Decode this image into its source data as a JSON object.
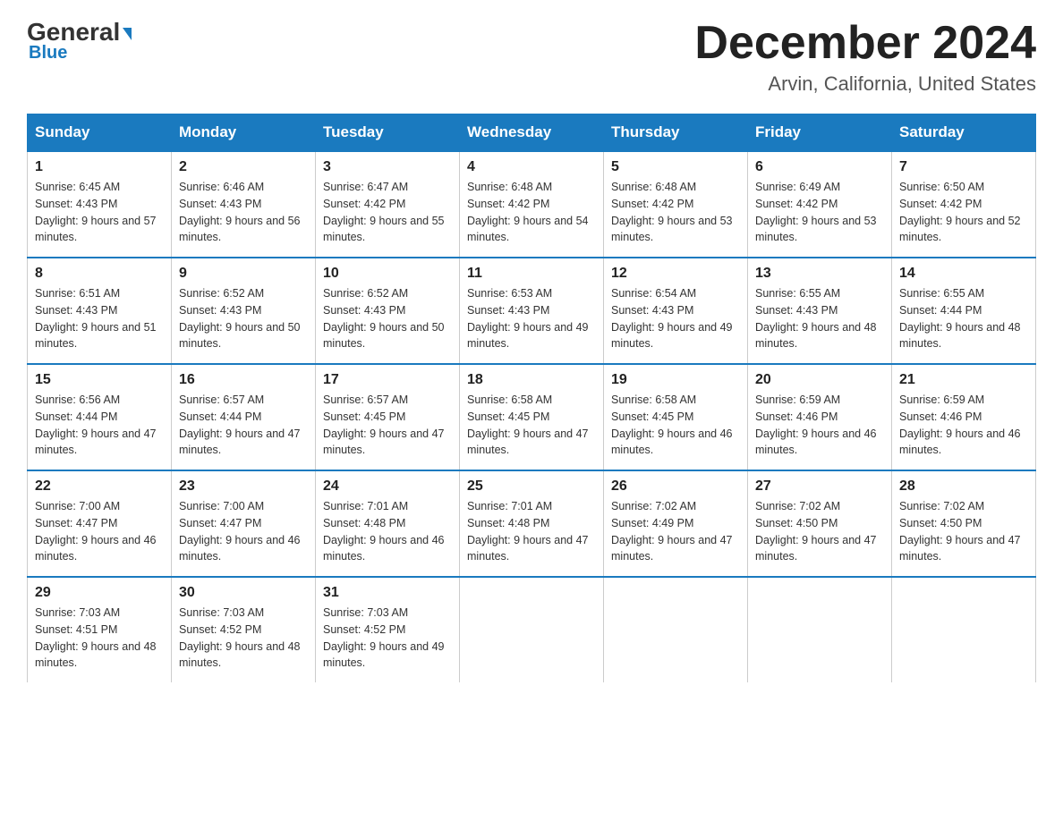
{
  "header": {
    "logo_general": "General",
    "logo_blue": "Blue",
    "month_title": "December 2024",
    "location": "Arvin, California, United States"
  },
  "days_of_week": [
    "Sunday",
    "Monday",
    "Tuesday",
    "Wednesday",
    "Thursday",
    "Friday",
    "Saturday"
  ],
  "weeks": [
    [
      {
        "day": "1",
        "sunrise": "6:45 AM",
        "sunset": "4:43 PM",
        "daylight": "9 hours and 57 minutes."
      },
      {
        "day": "2",
        "sunrise": "6:46 AM",
        "sunset": "4:43 PM",
        "daylight": "9 hours and 56 minutes."
      },
      {
        "day": "3",
        "sunrise": "6:47 AM",
        "sunset": "4:42 PM",
        "daylight": "9 hours and 55 minutes."
      },
      {
        "day": "4",
        "sunrise": "6:48 AM",
        "sunset": "4:42 PM",
        "daylight": "9 hours and 54 minutes."
      },
      {
        "day": "5",
        "sunrise": "6:48 AM",
        "sunset": "4:42 PM",
        "daylight": "9 hours and 53 minutes."
      },
      {
        "day": "6",
        "sunrise": "6:49 AM",
        "sunset": "4:42 PM",
        "daylight": "9 hours and 53 minutes."
      },
      {
        "day": "7",
        "sunrise": "6:50 AM",
        "sunset": "4:42 PM",
        "daylight": "9 hours and 52 minutes."
      }
    ],
    [
      {
        "day": "8",
        "sunrise": "6:51 AM",
        "sunset": "4:43 PM",
        "daylight": "9 hours and 51 minutes."
      },
      {
        "day": "9",
        "sunrise": "6:52 AM",
        "sunset": "4:43 PM",
        "daylight": "9 hours and 50 minutes."
      },
      {
        "day": "10",
        "sunrise": "6:52 AM",
        "sunset": "4:43 PM",
        "daylight": "9 hours and 50 minutes."
      },
      {
        "day": "11",
        "sunrise": "6:53 AM",
        "sunset": "4:43 PM",
        "daylight": "9 hours and 49 minutes."
      },
      {
        "day": "12",
        "sunrise": "6:54 AM",
        "sunset": "4:43 PM",
        "daylight": "9 hours and 49 minutes."
      },
      {
        "day": "13",
        "sunrise": "6:55 AM",
        "sunset": "4:43 PM",
        "daylight": "9 hours and 48 minutes."
      },
      {
        "day": "14",
        "sunrise": "6:55 AM",
        "sunset": "4:44 PM",
        "daylight": "9 hours and 48 minutes."
      }
    ],
    [
      {
        "day": "15",
        "sunrise": "6:56 AM",
        "sunset": "4:44 PM",
        "daylight": "9 hours and 47 minutes."
      },
      {
        "day": "16",
        "sunrise": "6:57 AM",
        "sunset": "4:44 PM",
        "daylight": "9 hours and 47 minutes."
      },
      {
        "day": "17",
        "sunrise": "6:57 AM",
        "sunset": "4:45 PM",
        "daylight": "9 hours and 47 minutes."
      },
      {
        "day": "18",
        "sunrise": "6:58 AM",
        "sunset": "4:45 PM",
        "daylight": "9 hours and 47 minutes."
      },
      {
        "day": "19",
        "sunrise": "6:58 AM",
        "sunset": "4:45 PM",
        "daylight": "9 hours and 46 minutes."
      },
      {
        "day": "20",
        "sunrise": "6:59 AM",
        "sunset": "4:46 PM",
        "daylight": "9 hours and 46 minutes."
      },
      {
        "day": "21",
        "sunrise": "6:59 AM",
        "sunset": "4:46 PM",
        "daylight": "9 hours and 46 minutes."
      }
    ],
    [
      {
        "day": "22",
        "sunrise": "7:00 AM",
        "sunset": "4:47 PM",
        "daylight": "9 hours and 46 minutes."
      },
      {
        "day": "23",
        "sunrise": "7:00 AM",
        "sunset": "4:47 PM",
        "daylight": "9 hours and 46 minutes."
      },
      {
        "day": "24",
        "sunrise": "7:01 AM",
        "sunset": "4:48 PM",
        "daylight": "9 hours and 46 minutes."
      },
      {
        "day": "25",
        "sunrise": "7:01 AM",
        "sunset": "4:48 PM",
        "daylight": "9 hours and 47 minutes."
      },
      {
        "day": "26",
        "sunrise": "7:02 AM",
        "sunset": "4:49 PM",
        "daylight": "9 hours and 47 minutes."
      },
      {
        "day": "27",
        "sunrise": "7:02 AM",
        "sunset": "4:50 PM",
        "daylight": "9 hours and 47 minutes."
      },
      {
        "day": "28",
        "sunrise": "7:02 AM",
        "sunset": "4:50 PM",
        "daylight": "9 hours and 47 minutes."
      }
    ],
    [
      {
        "day": "29",
        "sunrise": "7:03 AM",
        "sunset": "4:51 PM",
        "daylight": "9 hours and 48 minutes."
      },
      {
        "day": "30",
        "sunrise": "7:03 AM",
        "sunset": "4:52 PM",
        "daylight": "9 hours and 48 minutes."
      },
      {
        "day": "31",
        "sunrise": "7:03 AM",
        "sunset": "4:52 PM",
        "daylight": "9 hours and 49 minutes."
      },
      null,
      null,
      null,
      null
    ]
  ]
}
